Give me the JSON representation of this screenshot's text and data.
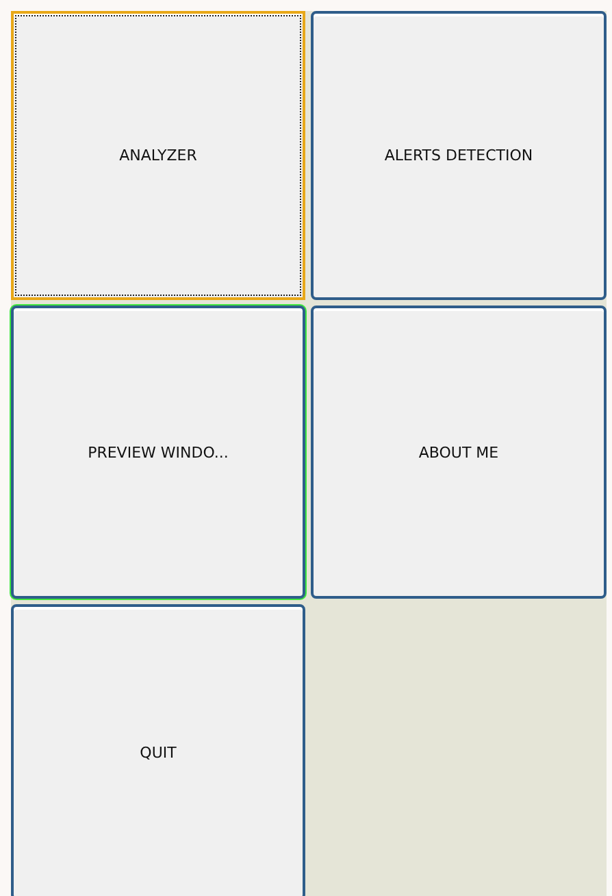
{
  "buttons": [
    {
      "label": "ANALYZER",
      "focused": true,
      "hovered": false
    },
    {
      "label": "ALERTS DETECTION",
      "focused": false,
      "hovered": false
    },
    {
      "label": "PREVIEW WINDO...",
      "focused": false,
      "hovered": true
    },
    {
      "label": "ABOUT ME",
      "focused": false,
      "hovered": false
    },
    {
      "label": "QUIT",
      "focused": false,
      "hovered": false
    }
  ]
}
